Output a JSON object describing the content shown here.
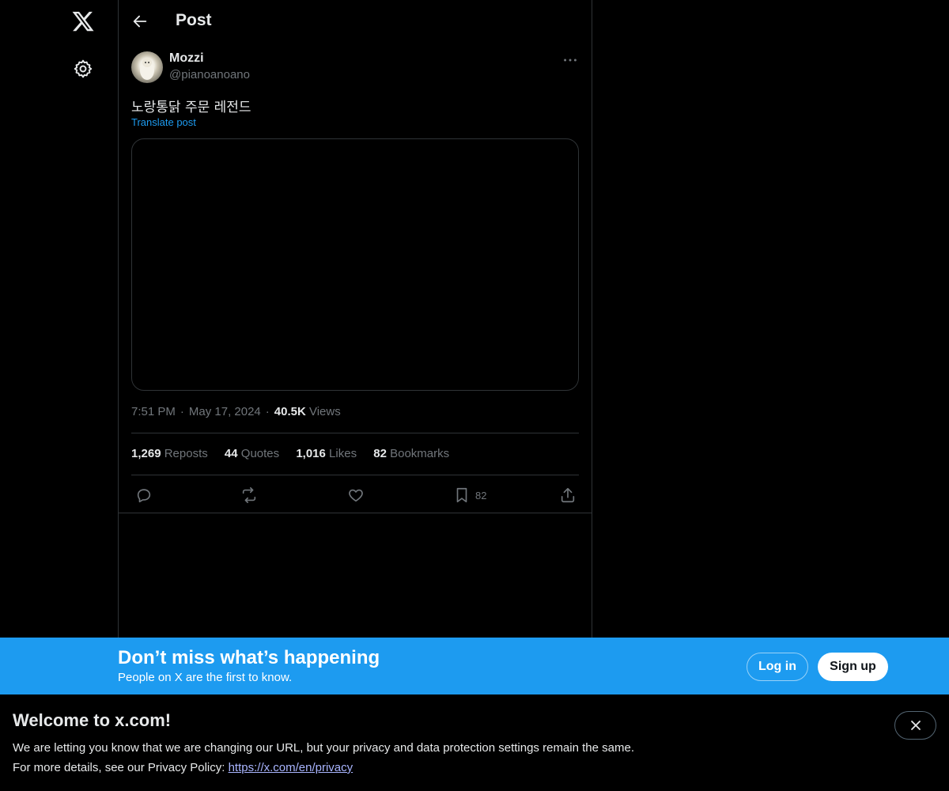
{
  "nav": {
    "logo": "x-logo-icon",
    "settings": "gear-icon"
  },
  "header": {
    "title": "Post",
    "back_icon": "arrow-left-icon"
  },
  "post": {
    "author_name": "Mozzi",
    "author_handle": "@pianoanoano",
    "text": "노랑통닭 주문 레전드",
    "translate_label": "Translate post",
    "time": "7:51 PM",
    "date": "May 17, 2024",
    "views_count": "40.5K",
    "views_label": "Views",
    "stats": {
      "reposts_count": "1,269",
      "reposts_label": "Reposts",
      "quotes_count": "44",
      "quotes_label": "Quotes",
      "likes_count": "1,016",
      "likes_label": "Likes",
      "bookmarks_count": "82",
      "bookmarks_label": "Bookmarks"
    },
    "actions": {
      "reply_icon": "reply-icon",
      "repost_icon": "repost-icon",
      "like_icon": "heart-icon",
      "bookmark_icon": "bookmark-icon",
      "bookmark_count": "82",
      "share_icon": "share-icon"
    }
  },
  "banner": {
    "title": "Don’t miss what’s happening",
    "subtitle": "People on X are the first to know.",
    "login_label": "Log in",
    "signup_label": "Sign up",
    "color": "#1d9bf0"
  },
  "notice": {
    "title": "Welcome to x.com!",
    "line1": "We are letting you know that we are changing our URL, but your privacy and data protection settings remain the same.",
    "line2_prefix": "For more details, see our Privacy Policy: ",
    "link_text": "https://x.com/en/privacy"
  },
  "colors": {
    "background": "#000000",
    "text": "#e7e9ea",
    "muted": "#71767b",
    "accent": "#1d9bf0",
    "border": "#2f3336"
  }
}
